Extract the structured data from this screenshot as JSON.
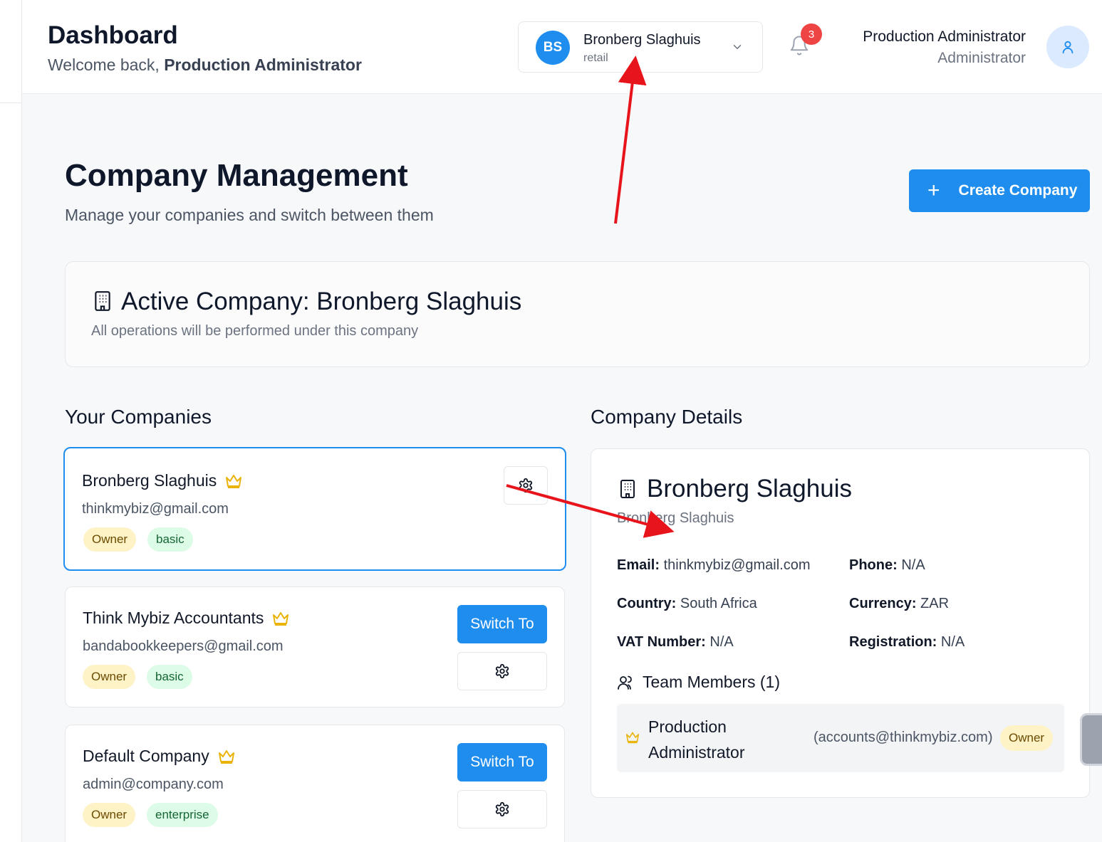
{
  "header": {
    "title": "Dashboard",
    "welcome_prefix": "Welcome back, ",
    "welcome_user": "Production Administrator",
    "company_switcher": {
      "initials": "BS",
      "name": "Bronberg Slaghuis",
      "type": "retail"
    },
    "notifications_count": "3",
    "user_name": "Production Administrator",
    "user_role": "Administrator"
  },
  "page": {
    "title": "Company Management",
    "subtitle": "Manage your companies and switch between them",
    "create_button": "Create Company"
  },
  "active_company": {
    "title": "Active Company: Bronberg Slaghuis",
    "subtitle": "All operations will be performed under this company"
  },
  "companies_section": {
    "heading": "Your Companies",
    "items": [
      {
        "name": "Bronberg Slaghuis",
        "email": "thinkmybiz@gmail.com",
        "role": "Owner",
        "plan": "basic"
      },
      {
        "name": "Think Mybiz Accountants",
        "email": "bandabookkeepers@gmail.com",
        "role": "Owner",
        "plan": "basic",
        "switch_label": "Switch To"
      },
      {
        "name": "Default Company",
        "email": "admin@company.com",
        "role": "Owner",
        "plan": "enterprise",
        "switch_label": "Switch To"
      }
    ]
  },
  "details_section": {
    "heading": "Company Details",
    "name": "Bronberg Slaghuis",
    "legal_name": "Bronberg Slaghuis",
    "fields": {
      "email_label": "Email:",
      "email": "thinkmybiz@gmail.com",
      "phone_label": "Phone:",
      "phone": "N/A",
      "country_label": "Country:",
      "country": "South Africa",
      "currency_label": "Currency:",
      "currency": "ZAR",
      "vat_label": "VAT Number:",
      "vat": "N/A",
      "registration_label": "Registration:",
      "registration": "N/A"
    },
    "team_heading": "Team Members (1)",
    "members": [
      {
        "name": "Production Administrator",
        "email": "(accounts@thinkmybiz.com)",
        "role": "Owner"
      }
    ]
  },
  "colors": {
    "accent": "#1f8ded",
    "annotation_arrow": "#e8141b",
    "owner_badge": "#fef3c7",
    "plan_badge": "#dcfce7",
    "crown": "#eab308",
    "notification_badge": "#ef4444"
  }
}
